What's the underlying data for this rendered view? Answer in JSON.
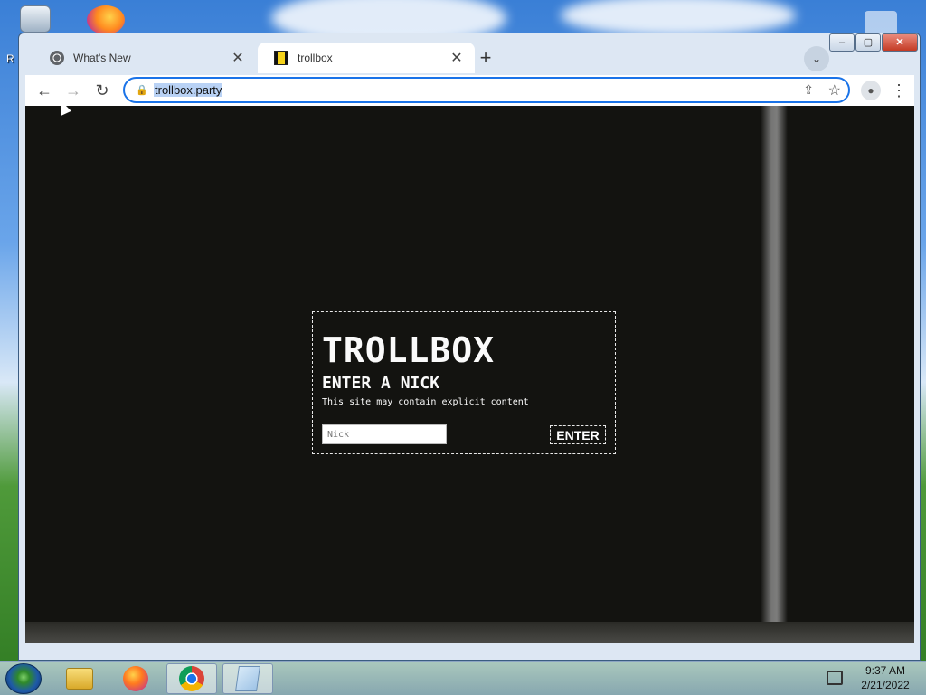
{
  "desktop": {
    "partial_icon_label": "R"
  },
  "browser": {
    "tabs": [
      {
        "title": "What's New",
        "active": false
      },
      {
        "title": "trollbox",
        "active": true
      }
    ],
    "new_tab_symbol": "+",
    "tab_search_symbol": "⌄",
    "window_controls": {
      "minimize": "–",
      "maximize": "▢",
      "close": "✕"
    },
    "nav": {
      "back": "←",
      "forward": "→",
      "reload": "↻"
    },
    "address": {
      "url": "trollbox.party",
      "lock_icon": "lock-icon"
    },
    "actions": {
      "share": "⇪",
      "bookmark": "☆",
      "profile": "●",
      "menu": "⋮"
    }
  },
  "page": {
    "title": "TROLLBOX",
    "subtitle": "ENTER A NICK",
    "warning": "This site may contain explicit content",
    "nick_placeholder": "Nick",
    "enter_label": "ENTER"
  },
  "taskbar": {
    "items": [
      {
        "name": "explorer",
        "icon": "folder-icon",
        "active": false
      },
      {
        "name": "firefox",
        "icon": "firefox-icon",
        "active": false
      },
      {
        "name": "chrome",
        "icon": "chrome-icon",
        "active": true
      },
      {
        "name": "notepad",
        "icon": "notepad-icon",
        "active": true
      }
    ],
    "clock": {
      "time": "9:37 AM",
      "date": "2/21/2022"
    }
  },
  "colors": {
    "page_background": "#131310",
    "omnibox_accent": "#1a73e8",
    "url_selection": "#b9d2f5",
    "dialog_border": "#e8e8e8"
  }
}
